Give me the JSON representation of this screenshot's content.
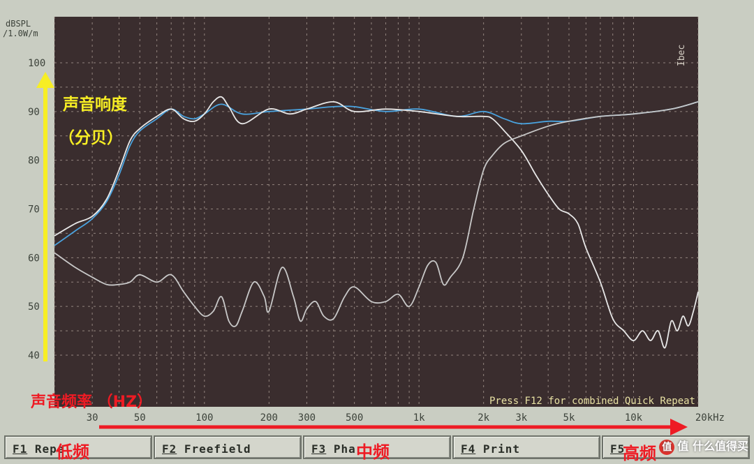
{
  "chart_data": {
    "type": "line",
    "y_unit_label": [
      "dBSPL",
      "/1.0W/m"
    ],
    "xlabel_unit": "20kHz",
    "ylim": [
      35,
      102
    ],
    "xlim": [
      20,
      20000
    ],
    "x_scale": "log",
    "grid": true,
    "y_ticks": [
      "40",
      "50",
      "60",
      "70",
      "80",
      "90",
      "100"
    ],
    "y_tick_values": [
      40,
      50,
      60,
      70,
      80,
      90,
      100
    ],
    "x_ticks": [
      "30",
      "50",
      "100",
      "200",
      "300",
      "500",
      "1k",
      "2k",
      "3k",
      "5k",
      "10k",
      "20kHz"
    ],
    "x_tick_values": [
      30,
      50,
      100,
      200,
      300,
      500,
      1000,
      2000,
      3000,
      5000,
      10000,
      20000
    ],
    "footer_note": "Press F12 for combined Quick Repeat",
    "series": [
      {
        "color": "#4aa3df",
        "x": [
          20,
          25,
          30,
          35,
          40,
          45,
          50,
          60,
          70,
          80,
          90,
          100,
          120,
          150,
          200,
          300,
          400,
          500,
          700,
          1000,
          1500,
          2000,
          2500,
          3000,
          4000,
          5000,
          7000,
          10000,
          15000,
          20000
        ],
        "y": [
          62.5,
          65.5,
          68,
          71.5,
          77,
          83,
          86,
          88.5,
          90.5,
          89,
          88.5,
          89.5,
          91.5,
          89.5,
          90,
          90.5,
          91,
          91,
          90,
          90.5,
          89,
          90,
          88.5,
          87.5,
          88,
          88,
          89,
          89.5,
          90.5,
          92
        ]
      },
      {
        "color": "#e8e8e8",
        "x": [
          20,
          25,
          30,
          35,
          40,
          45,
          50,
          60,
          70,
          80,
          90,
          100,
          110,
          120,
          130,
          150,
          200,
          250,
          300,
          400,
          500,
          700,
          1000,
          1500,
          2000,
          2200,
          2500,
          3000,
          3500,
          4000,
          4500,
          5000,
          5500,
          6000,
          7000,
          8000,
          9000,
          10000,
          11000,
          12000,
          13000,
          14000,
          15000,
          16000,
          17000,
          18000,
          19000,
          20000
        ],
        "y": [
          64.5,
          67,
          68.5,
          72,
          78,
          84,
          86.5,
          89,
          90.5,
          88.5,
          88,
          89.5,
          92,
          93,
          91,
          87.5,
          90.5,
          89.5,
          90.5,
          92,
          90,
          90.5,
          90,
          89,
          89,
          88.5,
          86,
          82,
          77,
          73,
          70,
          69,
          67,
          62,
          55,
          47.5,
          45,
          43,
          45,
          43,
          45,
          41.5,
          47,
          45,
          48,
          46,
          49,
          53
        ]
      },
      {
        "color": "#c8c8c8",
        "x": [
          20,
          25,
          30,
          35,
          40,
          45,
          50,
          60,
          70,
          80,
          90,
          100,
          110,
          120,
          130,
          140,
          150,
          170,
          190,
          200,
          230,
          260,
          280,
          300,
          330,
          360,
          400,
          450,
          500,
          600,
          700,
          800,
          900,
          1000,
          1100,
          1200,
          1300,
          1400,
          1600,
          1800,
          2000,
          2200,
          2500,
          3000,
          4000,
          5000,
          7000,
          10000,
          15000,
          20000
        ],
        "y": [
          61,
          58,
          56,
          54.5,
          54.5,
          55,
          56.5,
          55,
          56.5,
          53,
          50,
          48,
          49,
          52,
          47,
          46,
          49,
          55,
          52,
          49,
          58,
          52,
          47,
          49.5,
          51,
          48,
          47.5,
          52,
          54,
          51,
          51,
          52.5,
          50,
          54,
          58.5,
          59,
          54.5,
          56,
          60,
          70,
          78,
          81,
          83.5,
          85,
          87,
          88,
          89,
          89.5,
          90.5,
          92
        ]
      }
    ]
  },
  "annotations": {
    "y_axis_title_line1": "声音响度",
    "y_axis_title_line2": "（分贝）",
    "x_axis_title": "声音频率 （HZ）",
    "band_low": "低频",
    "band_mid": "中频",
    "band_high": "高频",
    "side_label": "Ibec"
  },
  "function_keys": [
    {
      "key": "F1",
      "label": " Repe"
    },
    {
      "key": "F2",
      "label": " Freefield"
    },
    {
      "key": "F3",
      "label": " Pha"
    },
    {
      "key": "F4",
      "label": " Print"
    },
    {
      "key": "F5",
      "label": ""
    }
  ],
  "watermark": {
    "text": "值 什么值得买",
    "logo": "值"
  },
  "colors": {
    "plot_bg": "#3a2d2e",
    "frame_bg": "#c9cdc2",
    "grid": "#a99a92",
    "red": "#ee1b24",
    "yellow": "#f7ee24",
    "note": "#e9e2a4"
  }
}
